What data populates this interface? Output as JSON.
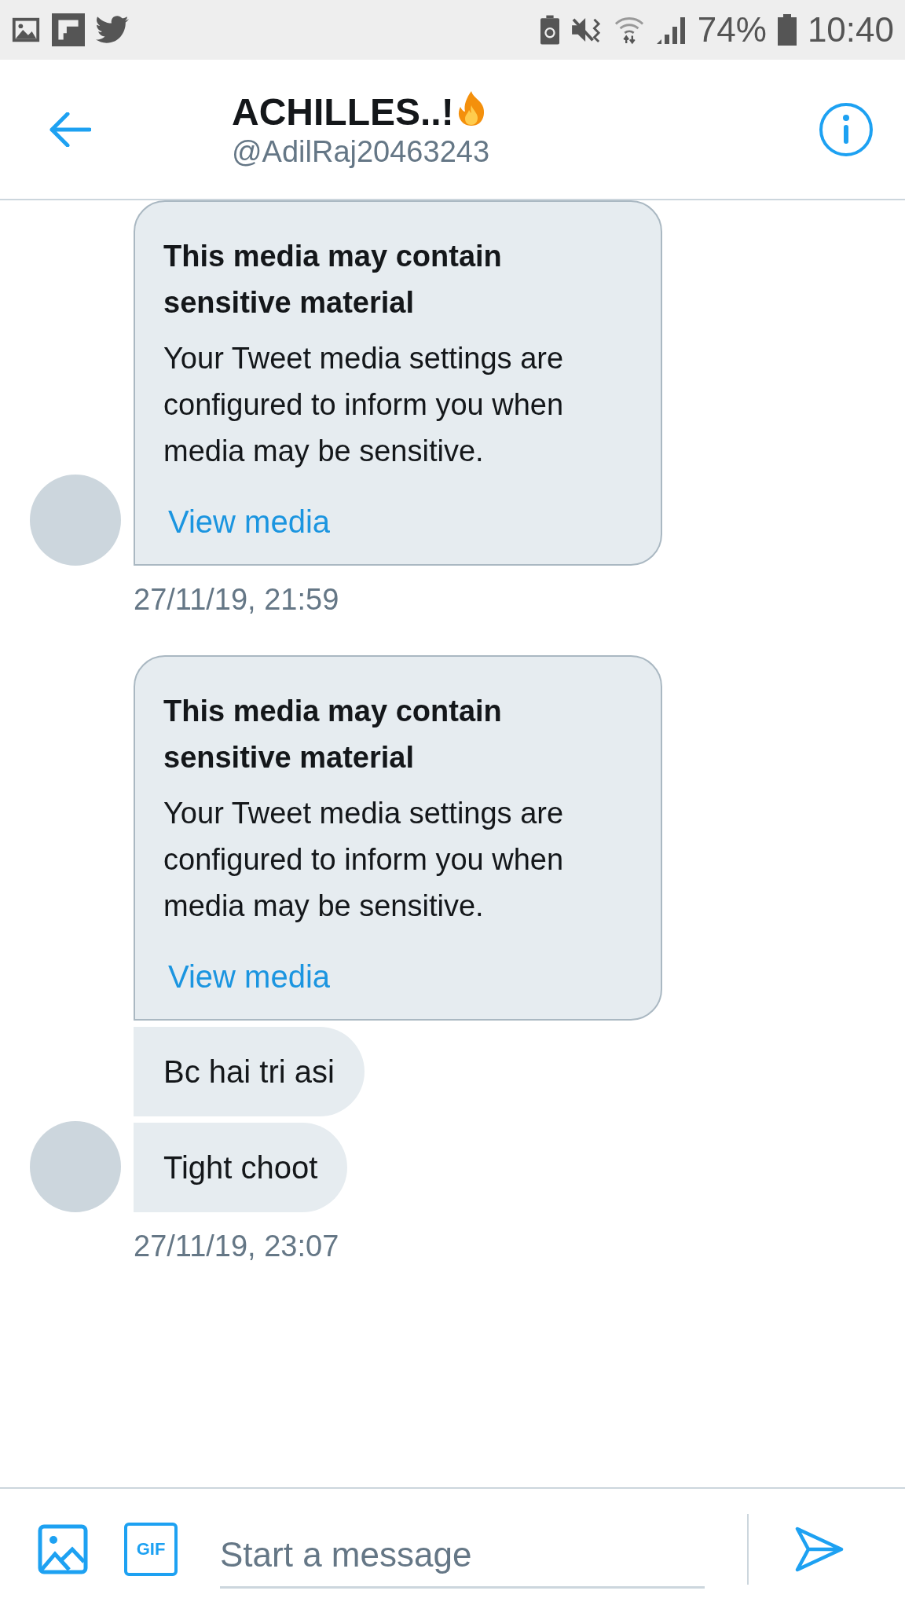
{
  "status_bar": {
    "battery_percent": "74%",
    "time": "10:40"
  },
  "header": {
    "name": "ACHILLES..!",
    "handle": "@AdilRaj20463243"
  },
  "groups": [
    {
      "messages": [
        {
          "kind": "media_notice",
          "title": "This media may contain sensitive material",
          "body": "Your Tweet media settings are configured to inform you when media may be sensitive.",
          "link": "View media"
        }
      ],
      "time": "27/11/19, 21:59"
    },
    {
      "messages": [
        {
          "kind": "media_notice",
          "title": "This media may contain sensitive material",
          "body": "Your Tweet media settings are configured to inform you when media may be sensitive.",
          "link": "View media"
        },
        {
          "kind": "text",
          "text": "Bc hai tri asi"
        },
        {
          "kind": "text",
          "text": "Tight choot"
        }
      ],
      "time": "27/11/19, 23:07"
    }
  ],
  "composer": {
    "placeholder": "Start a message",
    "gif_label": "GIF"
  }
}
